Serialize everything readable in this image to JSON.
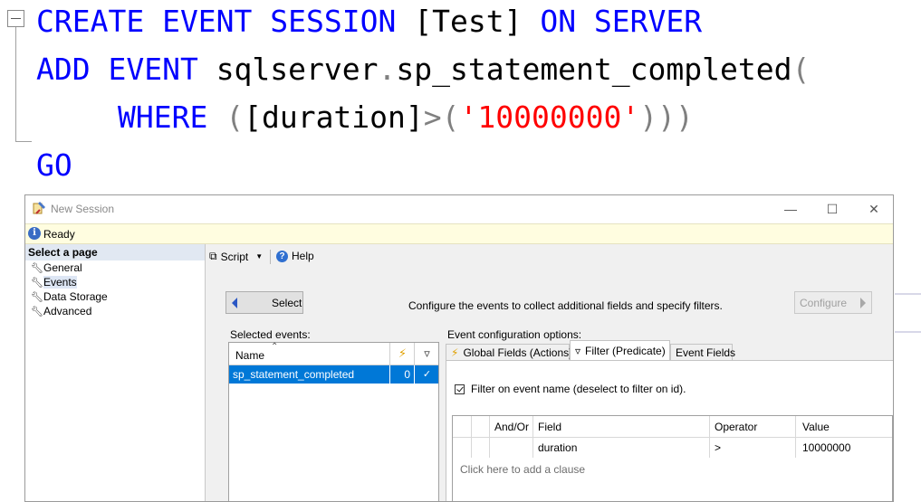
{
  "code": {
    "line1": {
      "kw1": "CREATE EVENT SESSION ",
      "name": "[Test]",
      "kw2": " ON SERVER"
    },
    "line2": {
      "kw1": "ADD EVENT ",
      "obj": "sqlserver",
      "dot": ".",
      "ev": "sp_statement_completed",
      "paren": "("
    },
    "line3": {
      "kw": "WHERE ",
      "p1": "(",
      "field": "[duration]",
      "op": ">",
      "p2": "(",
      "value": "'10000000'",
      "p3": ")))"
    },
    "line4": {
      "kw": "GO"
    }
  },
  "dialog": {
    "title": "New Session",
    "status": "Ready",
    "pages_header": "Select a page",
    "pages": [
      "General",
      "Events",
      "Data Storage",
      "Advanced"
    ],
    "toolbar": {
      "script": "Script",
      "help": "Help"
    },
    "select_label": "Select",
    "description": "Configure the events to collect additional fields and specify filters.",
    "configure_label": "Configure",
    "selected_events_label": "Selected events:",
    "event_options_label": "Event configuration options:",
    "events_grid": {
      "name_header": "Name",
      "rows": [
        {
          "name": "sp_statement_completed",
          "count": "0"
        }
      ]
    },
    "tabs": [
      "Global Fields (Actions)",
      "Filter (Predicate)",
      "Event Fields"
    ],
    "filter_checkbox_label": "Filter on event name (deselect to filter on id).",
    "predicate_grid": {
      "headers": {
        "andor": "And/Or",
        "field": "Field",
        "operator": "Operator",
        "value": "Value"
      },
      "rows": [
        {
          "field": "duration",
          "operator": ">",
          "value": "10000000"
        }
      ],
      "add_clause": "Click here to add a clause"
    }
  }
}
